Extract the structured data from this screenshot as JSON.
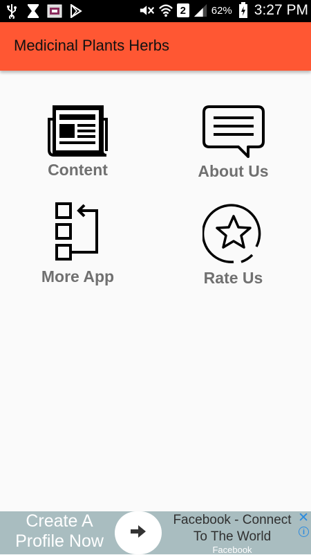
{
  "status_bar": {
    "battery_percent": "62%",
    "sim_slot": "2",
    "time": "3:27 PM",
    "left_icons": [
      "usb-icon",
      "hourglass-icon",
      "gallery-app-icon",
      "play-store-icon"
    ],
    "right_icons": [
      "mute-icon",
      "wifi-icon",
      "signal-icon",
      "battery-icon"
    ]
  },
  "app_bar": {
    "title": "Medicinal Plants Herbs",
    "color": "#ff5733"
  },
  "menu": [
    {
      "label": "Content",
      "icon": "newspaper-icon"
    },
    {
      "label": "About Us",
      "icon": "chat-bubble-icon"
    },
    {
      "label": "More App",
      "icon": "flowchart-icon"
    },
    {
      "label": "Rate Us",
      "icon": "star-circle-icon"
    }
  ],
  "ad": {
    "left_text_line1": "Create A",
    "left_text_line2": "Profile Now",
    "headline_line1": "Facebook - Connect",
    "headline_line2": "To The World",
    "advertiser": "Facebook",
    "close_glyph": "✕",
    "info_glyph": "i"
  }
}
